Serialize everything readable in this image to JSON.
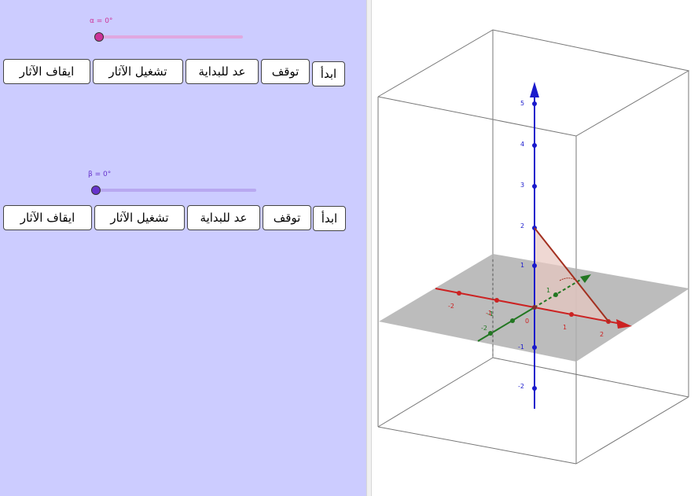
{
  "slider_alpha": {
    "label": "α = 0°",
    "value": 0,
    "color": "#cc3399",
    "track_color": "#e0a8e0"
  },
  "slider_beta": {
    "label": "β = 0°",
    "value": 0,
    "color": "#6633cc",
    "track_color": "#b8a8f0"
  },
  "row1": {
    "start": "ابدأ",
    "pause": "توقف",
    "reset": "عد للبداية",
    "trace_on": "تشغيل الآثار",
    "trace_off": "ايقاف الآثار"
  },
  "row2": {
    "start": "ابدأ",
    "pause": "توقف",
    "reset": "عد للبداية",
    "trace_on": "تشغيل الآثار",
    "trace_off": "ايقاف الآثار"
  },
  "graphics3d": {
    "z_ticks": [
      "5",
      "4",
      "3",
      "2",
      "1",
      "-1",
      "-2"
    ],
    "x_ticks": [
      "-2",
      "-1",
      "1",
      "2"
    ],
    "y_ticks": [
      "-2",
      "-1",
      "1"
    ],
    "origin_label": "0",
    "colors": {
      "x_axis": "#cc2222",
      "y_axis": "#227722",
      "z_axis": "#1a1acc",
      "plane": "#b0b0b0",
      "triangle": "#e8c8c0",
      "box": "#777777"
    }
  }
}
